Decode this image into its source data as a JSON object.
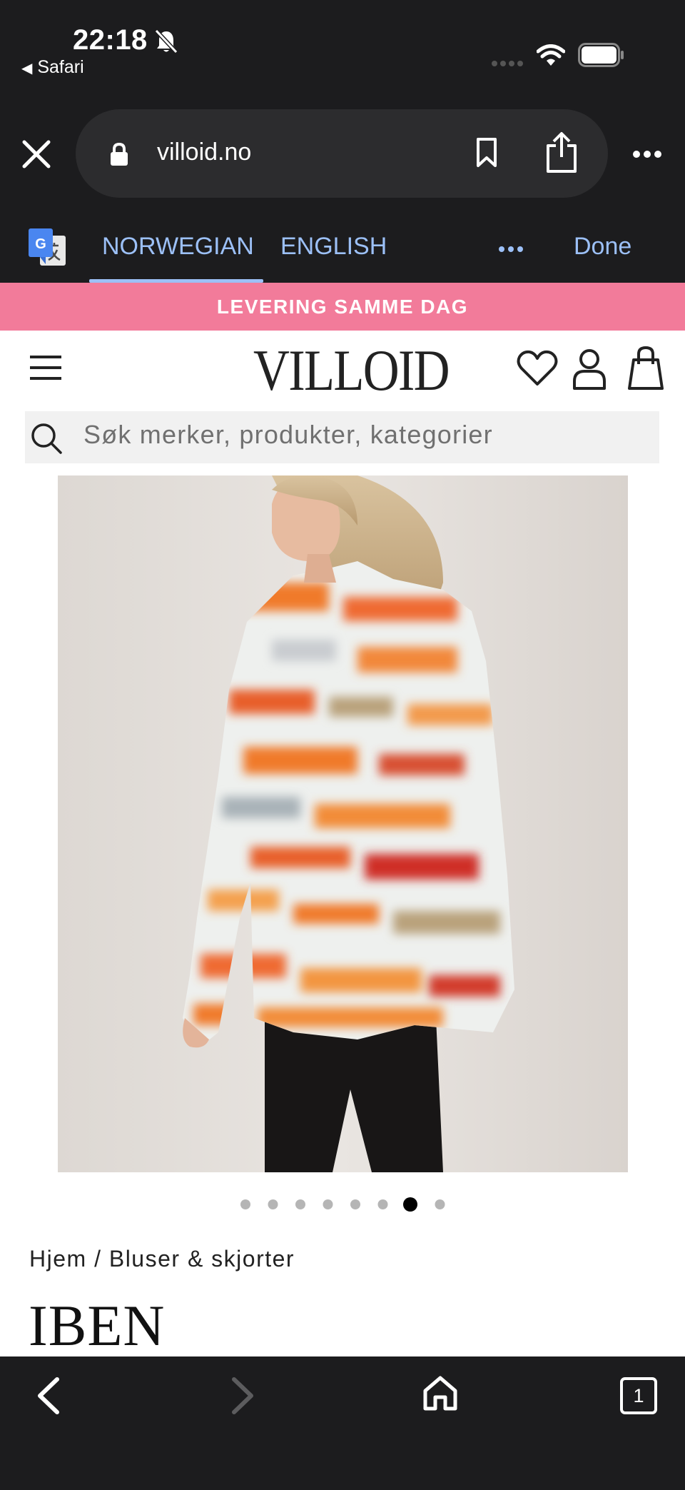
{
  "status_bar": {
    "time": "22:18",
    "back_app": "Safari",
    "icons": [
      "bell-mute-icon",
      "signal-icon",
      "wifi-icon",
      "battery-icon"
    ]
  },
  "browser": {
    "url": "villoid.no",
    "icons": [
      "close-icon",
      "lock-icon",
      "bookmark-icon",
      "share-icon",
      "more-icon"
    ]
  },
  "translate_bar": {
    "tabs": [
      {
        "label": "NORWEGIAN",
        "active": true
      },
      {
        "label": "ENGLISH",
        "active": false
      }
    ],
    "done_label": "Done",
    "colors": {
      "accent": "#9cc0f7"
    }
  },
  "promo_banner": {
    "text": "LEVERING SAMME DAG",
    "color": "#f27b9a"
  },
  "site_header": {
    "brand": "VILLOID",
    "icons": [
      "menu-icon",
      "heart-icon",
      "account-icon",
      "bag-icon"
    ]
  },
  "search": {
    "placeholder": "Søk merker, produkter, kategorier"
  },
  "product": {
    "breadcrumb": "Hjem / Bluser & skjorter",
    "title": "IBEN",
    "gallery": {
      "total_images": 8,
      "active_index": 7
    }
  },
  "toolbar": {
    "tab_count": "1",
    "icons": [
      "back-icon",
      "forward-icon",
      "home-icon",
      "tabs-icon"
    ]
  }
}
